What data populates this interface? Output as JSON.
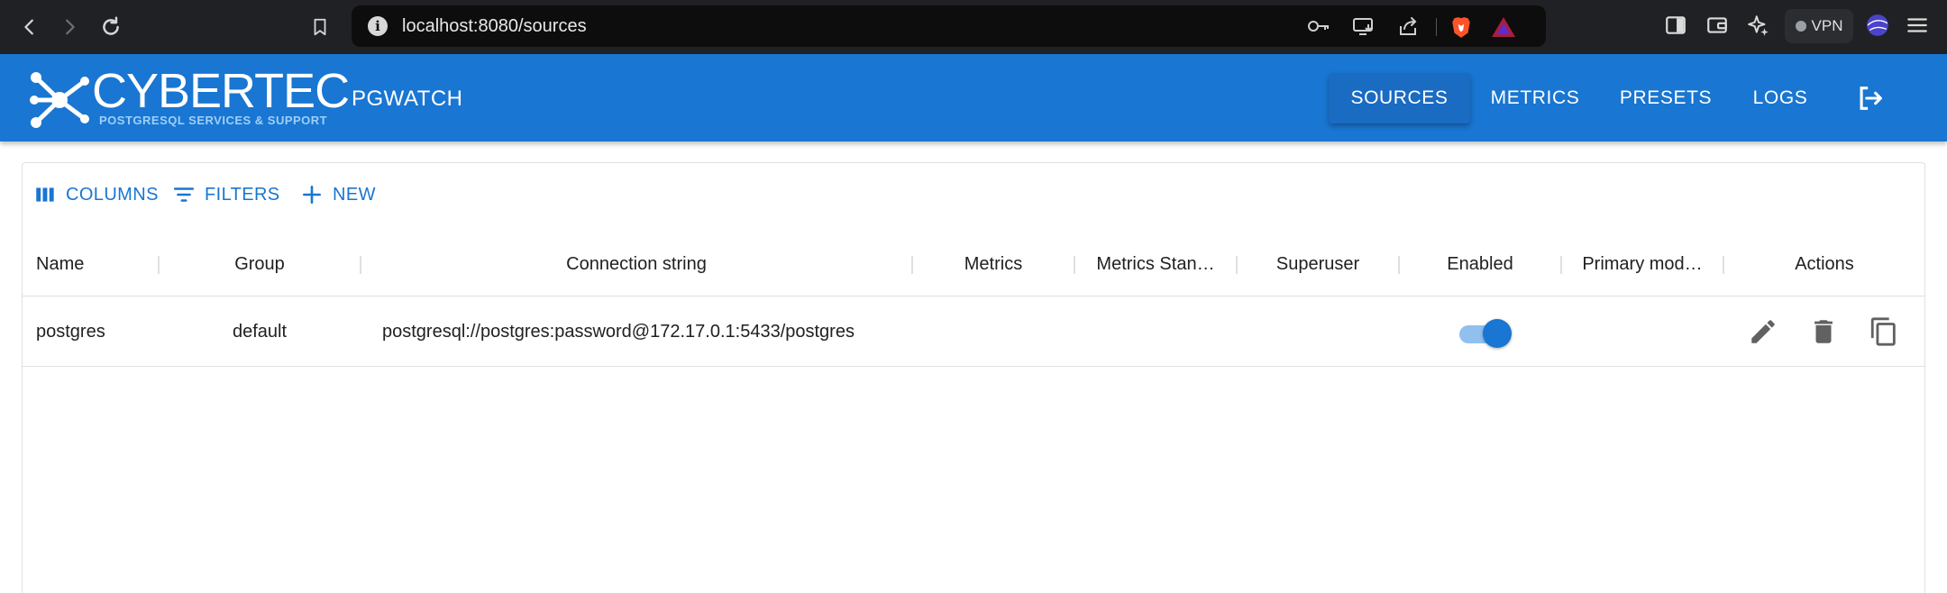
{
  "browser": {
    "url": "localhost:8080/sources",
    "vpn_label": "VPN"
  },
  "appbar": {
    "logo_text": "CYBERTEC",
    "logo_subtext": "POSTGRESQL SERVICES & SUPPORT",
    "app_title": "PGWATCH",
    "nav": [
      {
        "label": "SOURCES",
        "active": true
      },
      {
        "label": "METRICS",
        "active": false
      },
      {
        "label": "PRESETS",
        "active": false
      },
      {
        "label": "LOGS",
        "active": false
      }
    ],
    "logout_icon": "logout-icon"
  },
  "grid": {
    "toolbar": {
      "columns_label": "COLUMNS",
      "filters_label": "FILTERS",
      "new_label": "NEW"
    },
    "columns": [
      "Name",
      "Group",
      "Connection string",
      "Metrics",
      "Metrics Stan…",
      "Superuser",
      "Enabled",
      "Primary mod…",
      "Actions"
    ],
    "rows": [
      {
        "name": "postgres",
        "group": "default",
        "connection_string": "postgresql://postgres:password@172.17.0.1:5433/postgres",
        "metrics": "",
        "metrics_standby": "",
        "superuser": "",
        "enabled": true,
        "primary_mode": ""
      }
    ]
  },
  "colors": {
    "primary": "#1976d2",
    "chrome_bg": "#202124"
  }
}
